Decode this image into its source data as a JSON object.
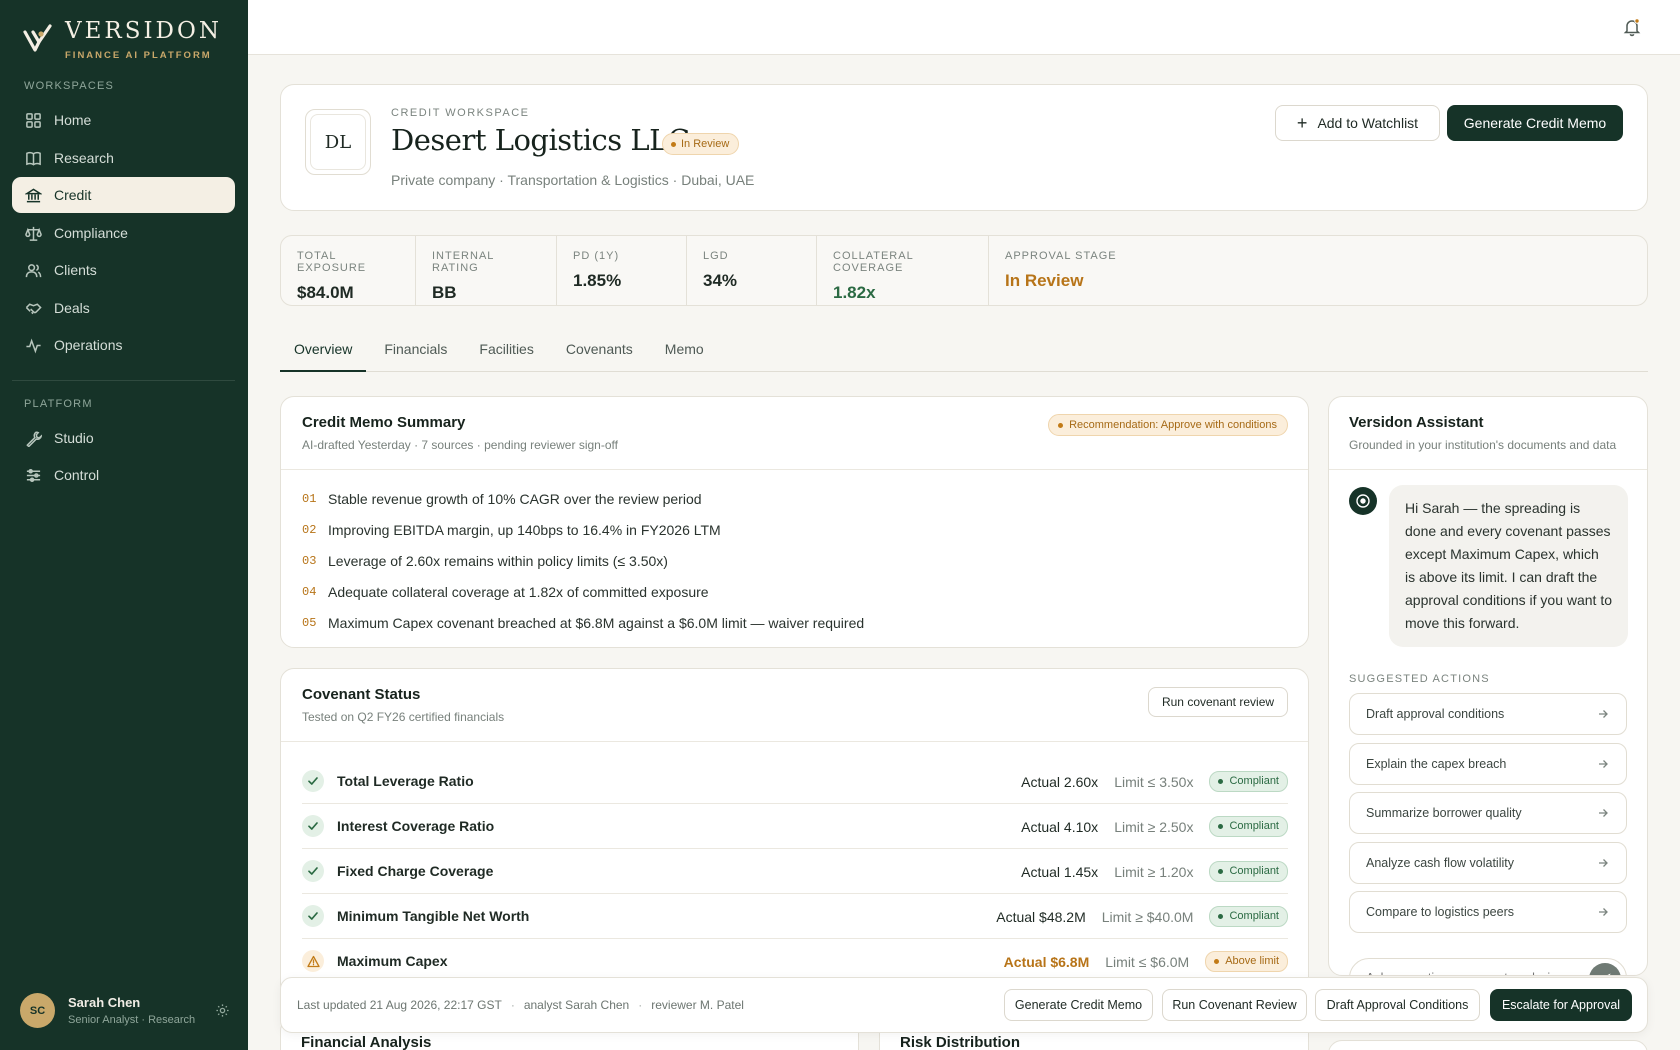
{
  "brand": {
    "name": "VERSIDON",
    "tagline": "FINANCE AI PLATFORM"
  },
  "sidebar": {
    "workspaces_label": "WORKSPACES",
    "platform_label": "PLATFORM",
    "workspaces": [
      {
        "label": "Home",
        "icon": "grid-icon"
      },
      {
        "label": "Research",
        "icon": "book-icon"
      },
      {
        "label": "Credit",
        "icon": "bank-icon",
        "active": true
      },
      {
        "label": "Compliance",
        "icon": "scale-icon"
      },
      {
        "label": "Clients",
        "icon": "users-icon"
      },
      {
        "label": "Deals",
        "icon": "handshake-icon"
      },
      {
        "label": "Operations",
        "icon": "activity-icon"
      }
    ],
    "platform": [
      {
        "label": "Studio",
        "icon": "wrench-icon"
      },
      {
        "label": "Control",
        "icon": "sliders-icon"
      }
    ]
  },
  "user": {
    "initials": "SC",
    "name": "Sarah Chen",
    "role": "Senior Analyst · Research"
  },
  "header": {
    "eyebrow": "CREDIT WORKSPACE",
    "company": "Desert Logistics LLC",
    "initials": "DL",
    "status": "In Review",
    "meta": "Private company · Transportation & Logistics · Dubai, UAE",
    "watch_label": "Add to Watchlist",
    "memo_label": "Generate Credit Memo"
  },
  "kpis": [
    {
      "label": "TOTAL EXPOSURE",
      "value": "$84.0M",
      "tone": ""
    },
    {
      "label": "INTERNAL RATING",
      "value": "BB",
      "tone": ""
    },
    {
      "label": "PD (1Y)",
      "value": "1.85%",
      "tone": ""
    },
    {
      "label": "LGD",
      "value": "34%",
      "tone": ""
    },
    {
      "label": "COLLATERAL COVERAGE",
      "value": "1.82x",
      "tone": "green"
    },
    {
      "label": "APPROVAL STAGE",
      "value": "In Review",
      "tone": "amber"
    }
  ],
  "tabs": [
    "Overview",
    "Financials",
    "Facilities",
    "Covenants",
    "Memo"
  ],
  "memo": {
    "title": "Credit Memo Summary",
    "subtitle": "AI-drafted Yesterday · 7 sources · pending reviewer sign-off",
    "recommendation": "Recommendation: Approve with conditions",
    "points": [
      {
        "num": "01",
        "text": "Stable revenue growth of 10% CAGR over the review period"
      },
      {
        "num": "02",
        "text": "Improving EBITDA margin, up 140bps to 16.4% in FY2026 LTM"
      },
      {
        "num": "03",
        "text": "Leverage of 2.60x remains within policy limits (≤ 3.50x)"
      },
      {
        "num": "04",
        "text": "Adequate collateral coverage at 1.82x of committed exposure"
      },
      {
        "num": "05",
        "text": "Maximum Capex covenant breached at $6.8M against a $6.0M limit — waiver required"
      }
    ]
  },
  "covenants": {
    "title": "Covenant Status",
    "subtitle": "Tested on Q2 FY26 certified financials",
    "run_label": "Run covenant review",
    "rows": [
      {
        "name": "Total Leverage Ratio",
        "actual": "Actual 2.60x",
        "limit": "Limit ≤ 3.50x",
        "status": "Compliant",
        "ok": true
      },
      {
        "name": "Interest Coverage Ratio",
        "actual": "Actual 4.10x",
        "limit": "Limit ≥ 2.50x",
        "status": "Compliant",
        "ok": true
      },
      {
        "name": "Fixed Charge Coverage",
        "actual": "Actual 1.45x",
        "limit": "Limit ≥ 1.20x",
        "status": "Compliant",
        "ok": true
      },
      {
        "name": "Minimum Tangible Net Worth",
        "actual": "Actual $48.2M",
        "limit": "Limit ≥ $40.0M",
        "status": "Compliant",
        "ok": true
      },
      {
        "name": "Maximum Capex",
        "actual": "Actual $6.8M",
        "limit": "Limit ≤ $6.0M",
        "status": "Above limit",
        "ok": false
      }
    ]
  },
  "sections": {
    "financial": "Financial Analysis",
    "risk": "Risk Distribution"
  },
  "action_bar": {
    "updated": "Last updated 21 Aug 2026, 22:17 GST",
    "analyst": "analyst Sarah Chen",
    "reviewer": "reviewer M. Patel",
    "buttons": [
      "Generate Credit Memo",
      "Run Covenant Review",
      "Draft Approval Conditions",
      "Escalate for Approval"
    ]
  },
  "assistant": {
    "title": "Versidon Assistant",
    "subtitle": "Grounded in your institution's documents and data",
    "message": "Hi Sarah — the spreading is done and every covenant passes except Maximum Capex, which is above its limit. I can draft the approval conditions if you want to move this forward.",
    "suggested_label": "SUGGESTED ACTIONS",
    "suggestions": [
      "Draft approval conditions",
      "Explain the capex breach",
      "Summarize borrower quality",
      "Analyze cash flow volatility",
      "Compare to logistics peers"
    ],
    "input_placeholder": "Ask a question or request analysis..."
  },
  "colors": {
    "sidebar": "#163328",
    "accent_gold": "#c9a86a",
    "amber": "#b77418",
    "green": "#2b6a43"
  }
}
